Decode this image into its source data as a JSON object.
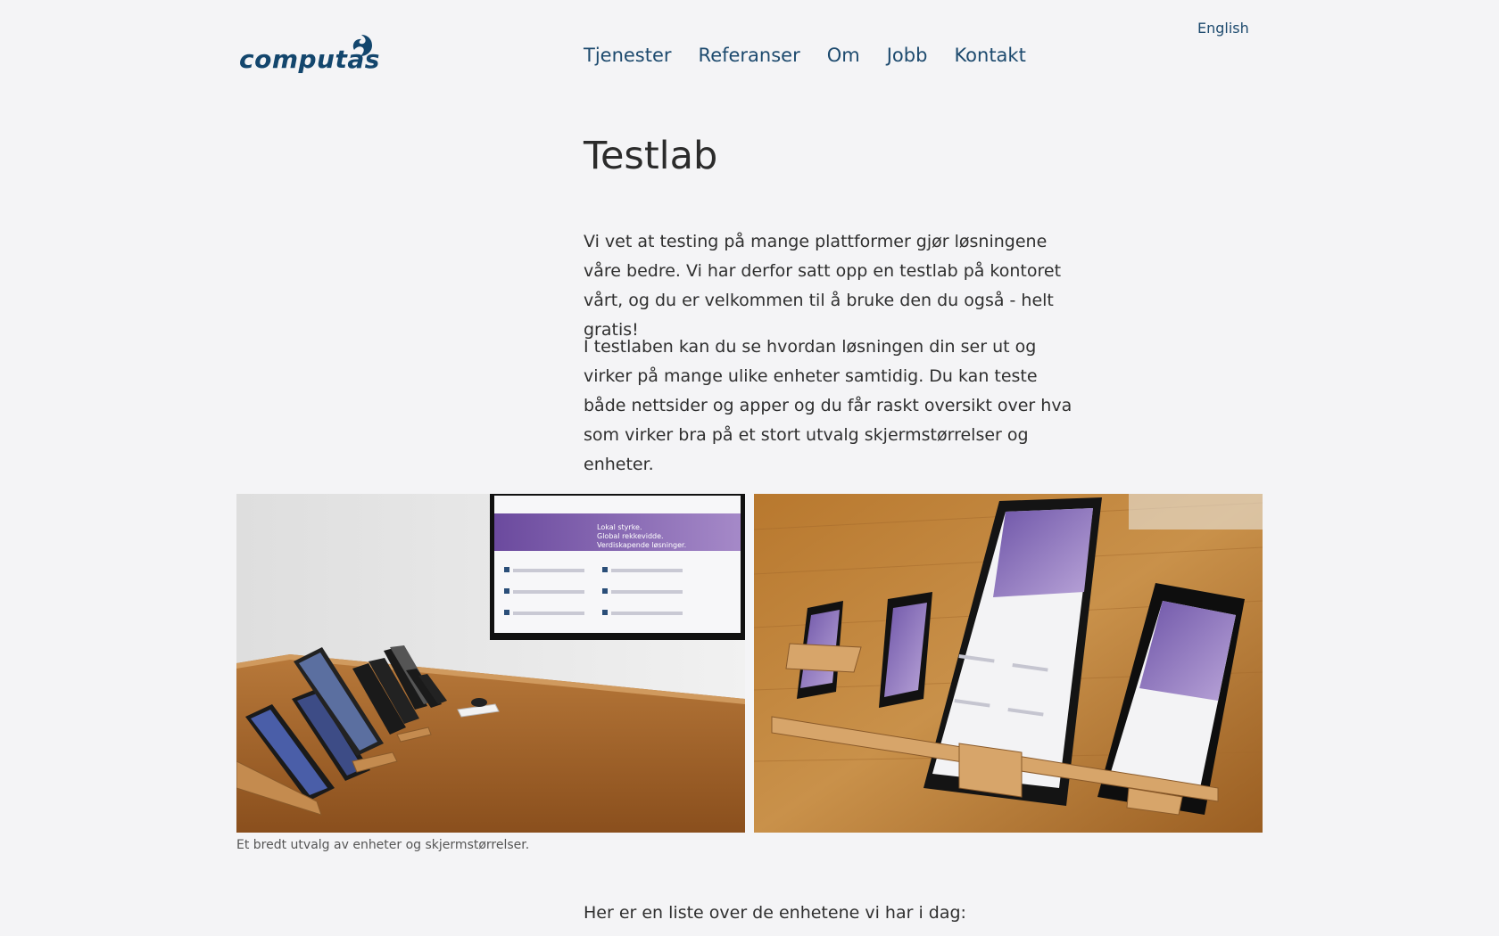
{
  "header": {
    "language_link": "English",
    "logo_text": "computas",
    "nav": [
      "Tjenester",
      "Referanser",
      "Om",
      "Jobb",
      "Kontakt"
    ]
  },
  "main": {
    "title": "Testlab",
    "paragraphs": [
      "Vi vet at testing på mange plattformer gjør løsningene våre bedre. Vi har derfor satt opp en testlab på kontoret vårt, og du er velkommen til å bruke den du også - helt gratis!",
      "I testlaben kan du se hvordan løsningen din ser ut og virker på mange ulike enheter samtidig. Du kan teste både nettsider og apper og du får raskt oversikt over hva som virker bra på et stort utvalg skjermstørrelser og enheter."
    ],
    "gallery": {
      "caption": "Et bredt utvalg av enheter og skjermstørrelser.",
      "screen_texts": [
        "Lokal styrke.",
        "Global rekkevidde.",
        "Verdiskapende løsninger."
      ]
    },
    "list_intro": "Her er en liste over de enhetene vi har i dag:"
  },
  "colors": {
    "brand": "#13466d",
    "nav_text": "#1d4a6e",
    "background": "#f4f4f6",
    "body_text": "#2f2f2f"
  }
}
